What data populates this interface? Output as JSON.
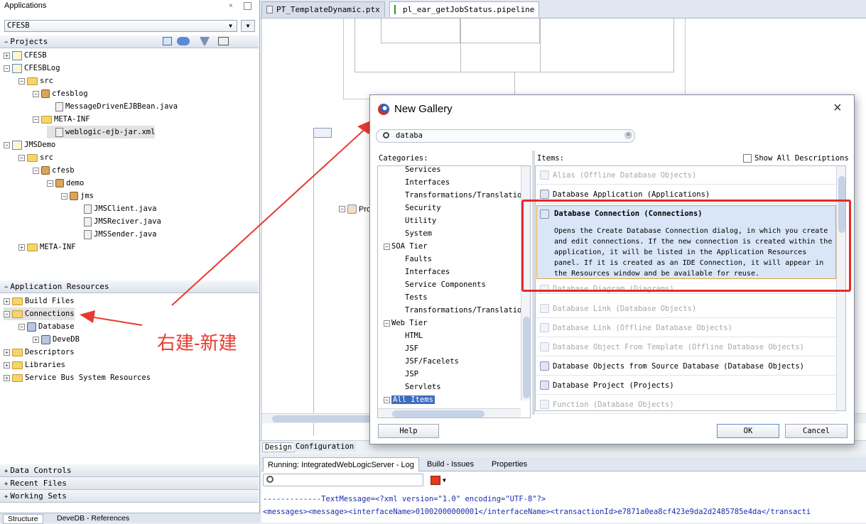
{
  "left": {
    "applications_label": "Applications",
    "app_select": "CFESB",
    "projects_label": "Projects",
    "tree": [
      {
        "label": "CFESB",
        "icon": "project-icon",
        "toggle": "+"
      },
      {
        "label": "CFESBLog",
        "icon": "project-icon",
        "toggle": "−"
      },
      {
        "label": "src",
        "icon": "folder-icon",
        "toggle": "−"
      },
      {
        "label": "cfesblog",
        "icon": "package-icon",
        "toggle": "−"
      },
      {
        "label": "MessageDrivenEJBBean.java",
        "icon": "java-file-icon",
        "toggle": ""
      },
      {
        "label": "META-INF",
        "icon": "folder-icon",
        "toggle": "−"
      },
      {
        "label": "weblogic-ejb-jar.xml",
        "icon": "xml-file-icon",
        "toggle": ""
      },
      {
        "label": "JMSDemo",
        "icon": "project-icon",
        "toggle": "−"
      },
      {
        "label": "src",
        "icon": "folder-icon",
        "toggle": "−"
      },
      {
        "label": "cfesb",
        "icon": "package-icon",
        "toggle": "−"
      },
      {
        "label": "demo",
        "icon": "package-icon",
        "toggle": "−"
      },
      {
        "label": "jms",
        "icon": "package-icon",
        "toggle": "−"
      },
      {
        "label": "JMSClient.java",
        "icon": "java-file-icon",
        "toggle": ""
      },
      {
        "label": "JMSReciver.java",
        "icon": "java-file-icon",
        "toggle": ""
      },
      {
        "label": "JMSSender.java",
        "icon": "java-file-icon",
        "toggle": ""
      },
      {
        "label": "META-INF",
        "icon": "folder-icon",
        "toggle": "+"
      }
    ],
    "app_resources_label": "Application Resources",
    "resources": [
      {
        "label": "Build Files",
        "icon": "folder-icon",
        "toggle": "+"
      },
      {
        "label": "Connections",
        "icon": "folder-icon",
        "toggle": "−"
      },
      {
        "label": "Database",
        "icon": "database-icon",
        "toggle": "−"
      },
      {
        "label": "DeveDB",
        "icon": "database-icon",
        "toggle": "+"
      },
      {
        "label": "Descriptors",
        "icon": "folder-icon",
        "toggle": "+"
      },
      {
        "label": "Libraries",
        "icon": "folder-icon",
        "toggle": "+"
      },
      {
        "label": "Service Bus System Resources",
        "icon": "folder-icon",
        "toggle": "+"
      }
    ],
    "bottom_sections": [
      "Data Controls",
      "Recent Files",
      "Working Sets"
    ],
    "bottom_tabs": [
      "Structure",
      "DeveDB - References"
    ]
  },
  "annotation": {
    "text": "右建-新建",
    "color": "#e83a2e"
  },
  "editor": {
    "tabs": [
      "PT_TemplateDynamic.ptx",
      "pl_ear_getJobStatus.pipeline"
    ],
    "canvas_label": "Pro",
    "bottom_tabs": [
      "Design",
      "Configuration"
    ]
  },
  "dialog": {
    "title": "New Gallery",
    "search_value": "databa",
    "categories_label": "Categories:",
    "items_label": "Items:",
    "show_all_label": "Show All Descriptions",
    "categories": [
      {
        "label": "Services",
        "level": 2
      },
      {
        "label": "Interfaces",
        "level": 2
      },
      {
        "label": "Transformations/Translation",
        "level": 2
      },
      {
        "label": "Security",
        "level": 2
      },
      {
        "label": "Utility",
        "level": 2
      },
      {
        "label": "System",
        "level": 2
      },
      {
        "label": "SOA Tier",
        "level": 1
      },
      {
        "label": "Faults",
        "level": 2
      },
      {
        "label": "Interfaces",
        "level": 2
      },
      {
        "label": "Service Components",
        "level": 2
      },
      {
        "label": "Tests",
        "level": 2
      },
      {
        "label": "Transformations/Translation",
        "level": 2
      },
      {
        "label": "Web Tier",
        "level": 1
      },
      {
        "label": "HTML",
        "level": 2
      },
      {
        "label": "JSF",
        "level": 2
      },
      {
        "label": "JSF/Facelets",
        "level": 2
      },
      {
        "label": "JSP",
        "level": 2
      },
      {
        "label": "Servlets",
        "level": 2
      },
      {
        "label": "All Items",
        "level": 1
      }
    ],
    "items": [
      {
        "label": "Alias (Offline Database Objects)",
        "enabled": false
      },
      {
        "label": "Database Application (Applications)",
        "enabled": true
      },
      {
        "label": "Database Diagram (Diagrams)",
        "enabled": false
      },
      {
        "label": "Database Link (Database Objects)",
        "enabled": false
      },
      {
        "label": "Database Link (Offline Database Objects)",
        "enabled": false
      },
      {
        "label": "Database Object From Template (Offline Database Objects)",
        "enabled": false
      },
      {
        "label": "Database Objects from Source Database (Database Objects)",
        "enabled": true
      },
      {
        "label": "Database Project (Projects)",
        "enabled": true
      },
      {
        "label": "Function (Database Objects)",
        "enabled": false
      }
    ],
    "selected_item": {
      "title": "Database Connection (Connections)",
      "description": "Opens the Create Database Connection dialog, in which you create and edit connections. If the new connection is created within the application, it will be listed in the Application Resources panel. If it is created as an IDE Connection, it will appear in the Resources window and be available for reuse."
    },
    "help_label": "Help",
    "ok_label": "OK",
    "cancel_label": "Cancel"
  },
  "log": {
    "tabs": [
      "Running: IntegratedWebLogicServer - Log",
      "Build - Issues",
      "Properties"
    ],
    "lines": [
      "-------------TextMessage=<?xml version=\"1.0\" encoding=\"UTF-8\"?>",
      "<messages><message><interfaceName>01002000000001</interfaceName><transactionId>e7871a0ea8cf423e9da2d2485785e4da</transacti"
    ]
  }
}
